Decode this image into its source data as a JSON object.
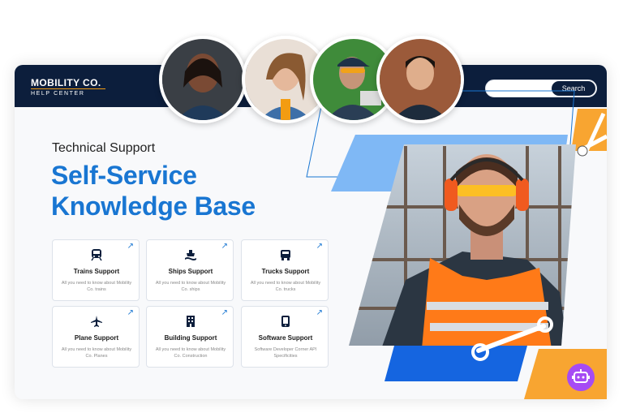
{
  "header": {
    "logo_main": "MOBILITY CO.",
    "logo_sub": "HELP CENTER",
    "search_label": "Search"
  },
  "hero": {
    "eyebrow": "Technical Support",
    "headline_line1": "Self-Service",
    "headline_line2": "Knowledge Base"
  },
  "tiles": [
    {
      "title": "Trains Support",
      "desc": "All you need to know about Mobility Co. trains",
      "icon": "train-icon"
    },
    {
      "title": "Ships Support",
      "desc": "All you need to know about Mobility Co. ships",
      "icon": "ship-icon"
    },
    {
      "title": "Trucks Support",
      "desc": "All you need to know about Mobility Co. trucks",
      "icon": "truck-icon"
    },
    {
      "title": "Plane Support",
      "desc": "All you need to know about Mobility Co. Planes",
      "icon": "plane-icon"
    },
    {
      "title": "Building Support",
      "desc": "All you need to know about Mobility Co. Construction",
      "icon": "building-icon"
    },
    {
      "title": "Software Support",
      "desc": "Software Developer Corner API Specificities",
      "icon": "tablet-icon"
    }
  ],
  "colors": {
    "navy": "#0c1e3c",
    "accent_blue": "#1976d2",
    "orange": "#f39c12",
    "purple": "#a64bf4"
  }
}
